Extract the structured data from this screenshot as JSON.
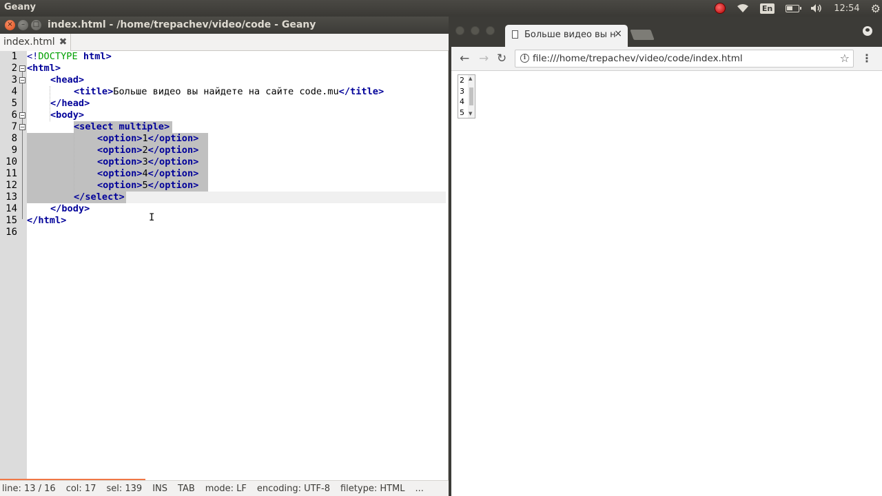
{
  "system": {
    "app_name": "Geany",
    "lang": "En",
    "time": "12:54"
  },
  "geany": {
    "title": "index.html - /home/trepachev/video/code - Geany",
    "tab": {
      "label": "index.html"
    },
    "lines": [
      "1",
      "2",
      "3",
      "4",
      "5",
      "6",
      "7",
      "8",
      "9",
      "10",
      "11",
      "12",
      "13",
      "14",
      "15",
      "16"
    ],
    "code": {
      "l1_a": "<!",
      "l1_b": "DOCTYPE",
      "l1_c": " html>",
      "l2": "<html>",
      "l3": "<head>",
      "l4_open": "<title>",
      "l4_text": "Больше видео вы найдете на сайте code.mu",
      "l4_close": "</title>",
      "l5": "</head>",
      "l6": "<body>",
      "l7": "<select multiple>",
      "options": [
        {
          "open": "<option>",
          "value": "1",
          "close": "</option>"
        },
        {
          "open": "<option>",
          "value": "2",
          "close": "</option>"
        },
        {
          "open": "<option>",
          "value": "3",
          "close": "</option>"
        },
        {
          "open": "<option>",
          "value": "4",
          "close": "</option>"
        },
        {
          "open": "<option>",
          "value": "5",
          "close": "</option>"
        }
      ],
      "l13": "</select>",
      "l14": "</body>",
      "l15": "</html>"
    },
    "status": {
      "line": "line: 13 / 16",
      "col": "col: 17",
      "sel": "sel: 139",
      "ins": "INS",
      "tab": "TAB",
      "mode": "mode: LF",
      "encoding": "encoding: UTF-8",
      "filetype": "filetype: HTML",
      "more": "..."
    }
  },
  "chrome": {
    "tab_title": "Больше видео вы н",
    "url": "file:///home/trepachev/video/code/index.html",
    "select_options": [
      "2",
      "3",
      "4",
      "5"
    ]
  },
  "colors": {
    "tag": "#000099",
    "doctype": "#009f00",
    "selection": "#c0c0c0",
    "accent": "#f07746"
  }
}
